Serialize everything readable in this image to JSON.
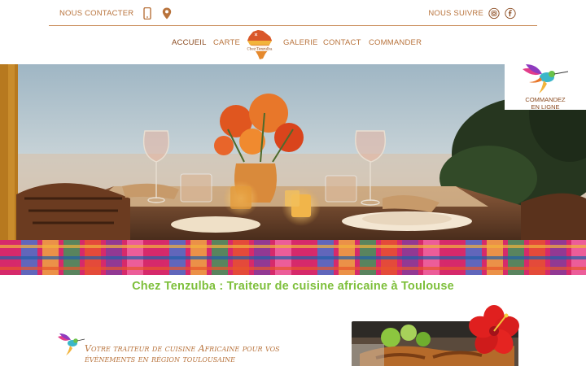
{
  "topbar": {
    "contact_label": "NOUS CONTACTER",
    "follow_label": "NOUS SUIVRE",
    "icons": [
      "phone-icon",
      "map-pin-icon",
      "instagram-icon",
      "facebook-icon"
    ]
  },
  "nav": {
    "items": [
      {
        "label": "ACCUEIL",
        "active": true
      },
      {
        "label": "CARTE",
        "active": false
      },
      {
        "label": "GALERIE",
        "active": false
      },
      {
        "label": "CONTACT",
        "active": false
      },
      {
        "label": "COMMANDER",
        "active": false
      }
    ],
    "logo_text": "Chez Tenzulba"
  },
  "order_badge": {
    "label_line1": "COMMANDEZ",
    "label_line2": "EN LIGNE",
    "icon": "hummingbird-icon"
  },
  "hero": {
    "icon": "dinner-table-photo"
  },
  "tagline": "Chez Tenzulba : Traiteur de cuisine africaine à Toulouse",
  "section": {
    "subtitle_line1": "Votre traiteur de cuisine Africaine pour vos",
    "subtitle_line2": "évènements en région toulousaine"
  },
  "colors": {
    "accent": "#b8733c",
    "accent_dark": "#8a4a1f",
    "green": "#7dbf3a"
  }
}
